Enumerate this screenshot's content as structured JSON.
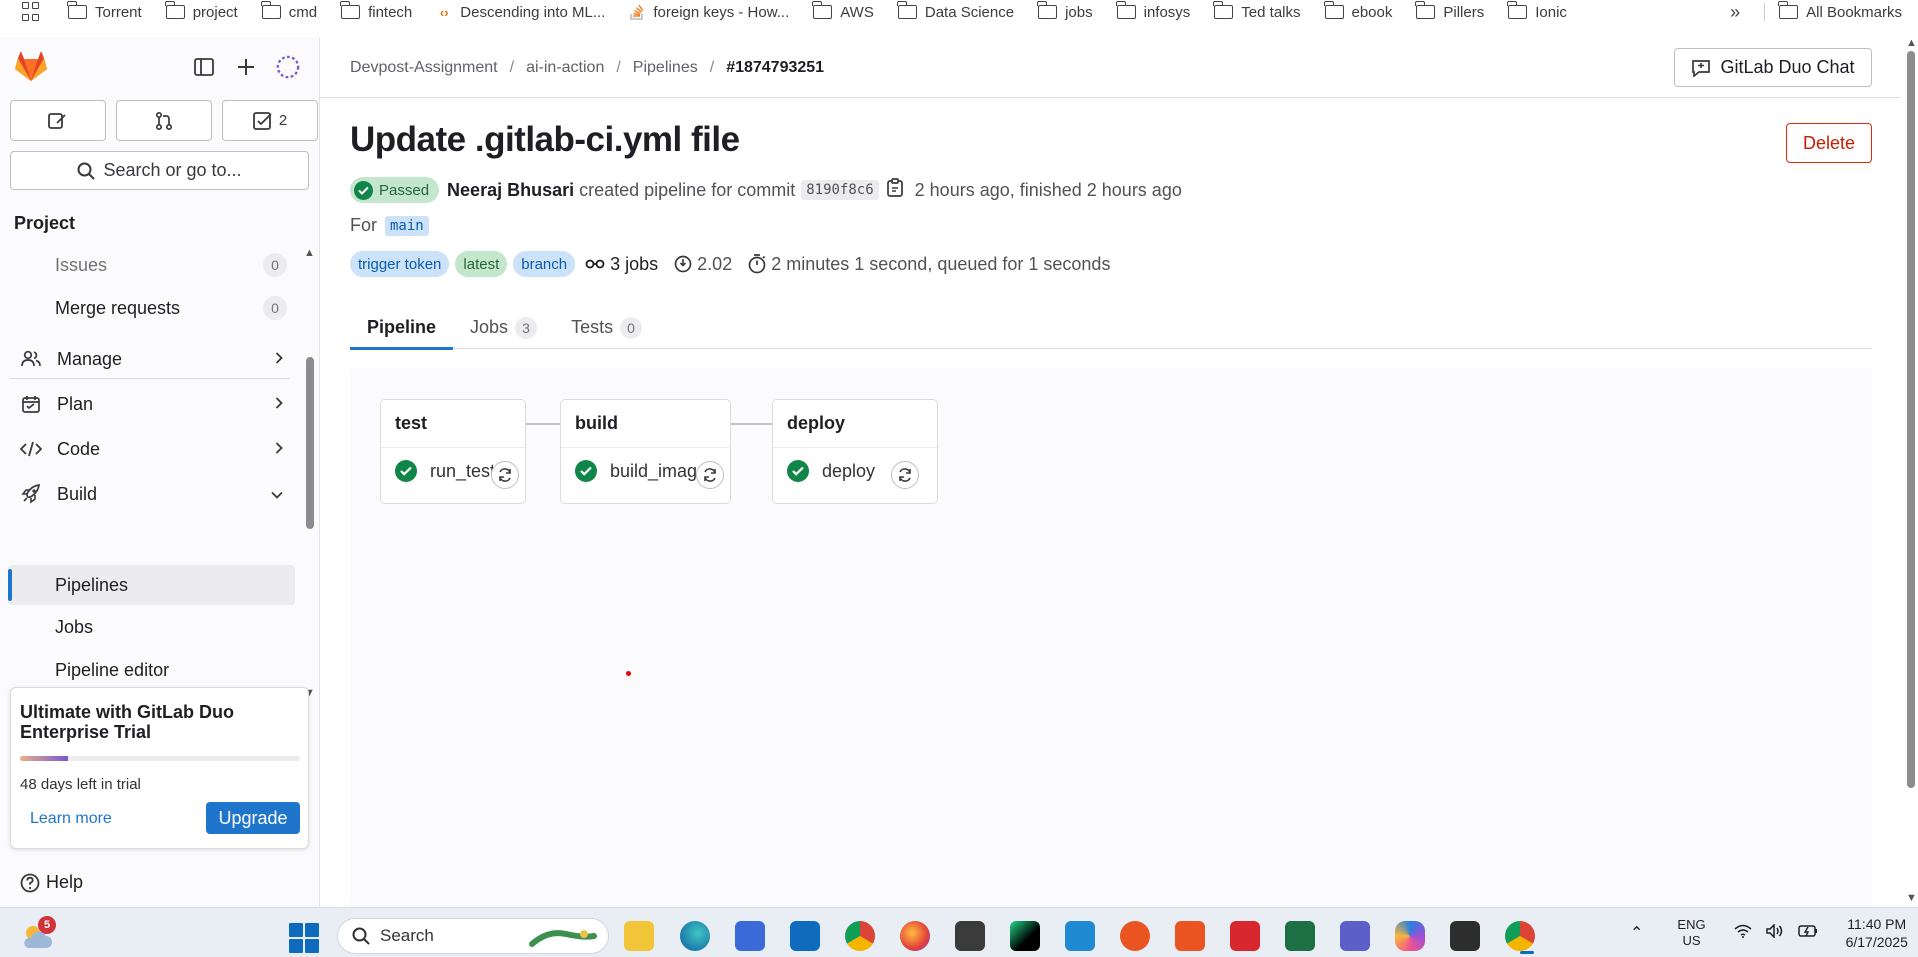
{
  "bookmarks": {
    "items": [
      {
        "label": "Torrent",
        "icon": "folder-icon"
      },
      {
        "label": "project",
        "icon": "folder-icon"
      },
      {
        "label": "cmd",
        "icon": "folder-icon"
      },
      {
        "label": "fintech",
        "icon": "folder-icon"
      },
      {
        "label": "Descending into ML...",
        "icon": "site-icon"
      },
      {
        "label": "foreign keys - How...",
        "icon": "stackoverflow-icon"
      },
      {
        "label": "AWS",
        "icon": "folder-icon"
      },
      {
        "label": "Data Science",
        "icon": "folder-icon"
      },
      {
        "label": "jobs",
        "icon": "folder-icon"
      },
      {
        "label": "infosys",
        "icon": "folder-icon"
      },
      {
        "label": "Ted talks",
        "icon": "folder-icon"
      },
      {
        "label": "ebook",
        "icon": "folder-icon"
      },
      {
        "label": "Pillers",
        "icon": "folder-icon"
      },
      {
        "label": "Ionic",
        "icon": "folder-icon"
      }
    ],
    "more": "»",
    "all_bookmarks": "All Bookmarks"
  },
  "sidebar": {
    "todo_count": "2",
    "search_label": "Search or go to...",
    "section_title": "Project",
    "nav": {
      "issues": {
        "label": "Issues",
        "count": "0"
      },
      "merge_requests": {
        "label": "Merge requests",
        "count": "0"
      },
      "manage": "Manage",
      "plan": "Plan",
      "code": "Code",
      "build": "Build",
      "pipelines": "Pipelines",
      "jobs": "Jobs",
      "pipeline_editor": "Pipeline editor"
    },
    "trial": {
      "title": "Ultimate with GitLab Duo Enterprise Trial",
      "progress": 0.17,
      "days_left": "48 days left in trial",
      "learn_more": "Learn more",
      "upgrade": "Upgrade"
    },
    "help": "Help"
  },
  "breadcrumb": [
    "Devpost-Assignment",
    "ai-in-action",
    "Pipelines",
    "#1874793251"
  ],
  "duo_chat": "GitLab Duo Chat",
  "pipeline": {
    "title": "Update .gitlab-ci.yml file",
    "delete": "Delete",
    "status": "Passed",
    "author": "Neeraj Bhusari",
    "created_text": "created pipeline for commit",
    "commit_sha": "8190f8c6",
    "time_text": "2 hours ago, finished 2 hours ago",
    "for_label": "For",
    "branch": "main",
    "tags": [
      {
        "label": "trigger token",
        "variant": "blue"
      },
      {
        "label": "latest",
        "variant": "green"
      },
      {
        "label": "branch",
        "variant": "blue"
      }
    ],
    "jobs_count": "3 jobs",
    "compute_minutes": "2.02",
    "duration": "2 minutes 1 second, queued for 1 seconds"
  },
  "tabs": [
    {
      "label": "Pipeline",
      "count": null,
      "active": true
    },
    {
      "label": "Jobs",
      "count": "3",
      "active": false
    },
    {
      "label": "Tests",
      "count": "0",
      "active": false
    }
  ],
  "stages": [
    {
      "name": "test",
      "job": "run_tests"
    },
    {
      "name": "build",
      "job": "build_image"
    },
    {
      "name": "deploy",
      "job": "deploy"
    }
  ],
  "taskbar": {
    "weather_badge": "5",
    "search": "Search",
    "lang1": "ENG",
    "lang2": "US",
    "time": "11:40 PM",
    "date": "6/17/2025"
  },
  "colors": {
    "accent": "#1f75cb",
    "success": "#108548",
    "danger": "#dd2b0e"
  }
}
